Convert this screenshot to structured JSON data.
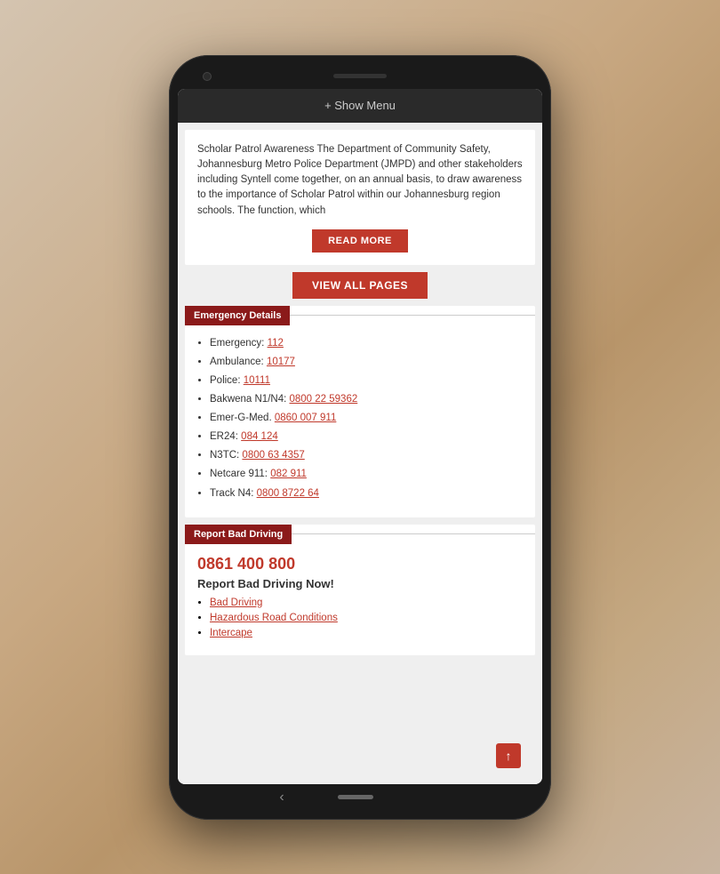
{
  "menu": {
    "label": "+ Show Menu"
  },
  "article": {
    "text": "Scholar Patrol Awareness The Department of Community Safety, Johannesburg Metro Police Department (JMPD) and other stakeholders including Syntell come together, on an annual basis, to draw awareness to the importance of Scholar Patrol within our Johannesburg region schools. The function, which",
    "read_more_label": "READ MORE"
  },
  "view_all_label": "VIEW ALL PAGES",
  "emergency_section": {
    "title": "Emergency Details",
    "items": [
      {
        "label": "Emergency: ",
        "number": "112",
        "href": "112"
      },
      {
        "label": "Ambulance: ",
        "number": "10177",
        "href": "10177"
      },
      {
        "label": "Police: ",
        "number": "10111",
        "href": "10111"
      },
      {
        "label": "Bakwena N1/N4: ",
        "number": "0800 22 59362",
        "href": "08002259362"
      },
      {
        "label": "Emer-G-Med. ",
        "number": "0860 007 911",
        "href": "0860007911"
      },
      {
        "label": "ER24: ",
        "number": "084 124",
        "href": "084124"
      },
      {
        "label": "N3TC: ",
        "number": "0800 63 4357",
        "href": "080063 4357"
      },
      {
        "label": "Netcare 911: ",
        "number": "082 911",
        "href": "082911"
      },
      {
        "label": "Track N4: ",
        "number": "0800 8722 64",
        "href": "0800872264"
      }
    ]
  },
  "report_section": {
    "title": "Report Bad Driving",
    "phone": "0861 400 800",
    "subtitle": "Report Bad Driving Now!",
    "links": [
      {
        "label": "Bad Driving"
      },
      {
        "label": "Hazardous Road Conditions"
      },
      {
        "label": "Intercape"
      }
    ]
  },
  "scroll_top_icon": "↑",
  "nav": {
    "back": "‹"
  }
}
